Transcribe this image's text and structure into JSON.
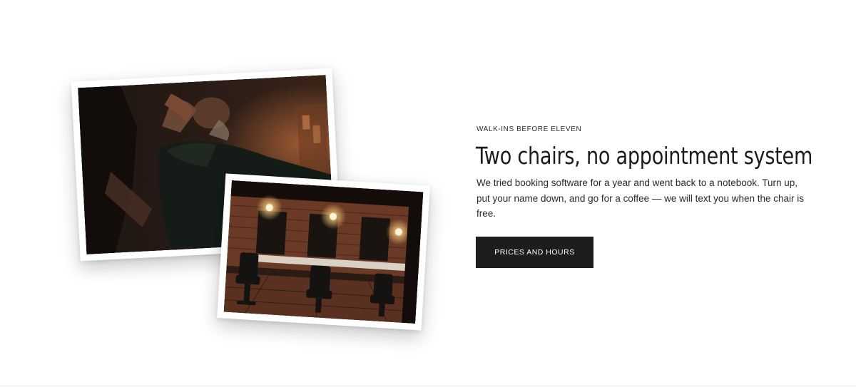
{
  "feature": {
    "eyebrow": "WALK-INS BEFORE ELEVEN",
    "headline": "Two chairs, no appointment system",
    "body": "We tried booking software for a year and went back to a notebook. Turn up, put your name down, and go for a coffee — we will text you when the chair is free.",
    "cta_label": "PRICES AND HOURS"
  },
  "images": [
    {
      "depicts": "barber-shaving-customer"
    },
    {
      "depicts": "barbershop-interior-with-chairs"
    }
  ]
}
